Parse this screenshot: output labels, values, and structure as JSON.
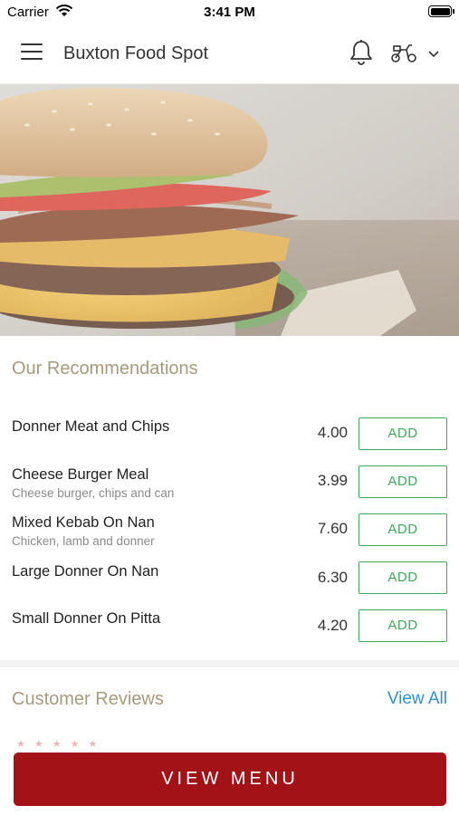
{
  "status_bar": {
    "carrier": "Carrier",
    "time": "3:41 PM"
  },
  "header": {
    "title": "Buxton Food Spot",
    "icons": [
      "menu-icon",
      "bell-icon",
      "scooter-icon",
      "chevron-down-icon"
    ]
  },
  "hero": {
    "image": "burger-photo"
  },
  "recommendations": {
    "title": "Our Recommendations",
    "items": [
      {
        "name": "Donner Meat and Chips",
        "description": "",
        "price": "4.00",
        "button": "ADD"
      },
      {
        "name": "Cheese Burger Meal",
        "description": "Cheese burger, chips and can",
        "price": "3.99",
        "button": "ADD"
      },
      {
        "name": "Mixed Kebab On Nan",
        "description": "Chicken, lamb and donner",
        "price": "7.60",
        "button": "ADD"
      },
      {
        "name": "Large Donner On Nan",
        "description": "",
        "price": "6.30",
        "button": "ADD"
      },
      {
        "name": "Small Donner On Pitta",
        "description": "",
        "price": "4.20",
        "button": "ADD"
      }
    ]
  },
  "reviews": {
    "title": "Customer Reviews",
    "view_all": "View All",
    "stars": "★★★★★"
  },
  "footer": {
    "view_menu": "VIEW MENU"
  },
  "colors": {
    "accent_red": "#a31217",
    "add_green": "#43a85a",
    "section_title": "#a89a7c",
    "link_blue": "#2f8fcf"
  }
}
